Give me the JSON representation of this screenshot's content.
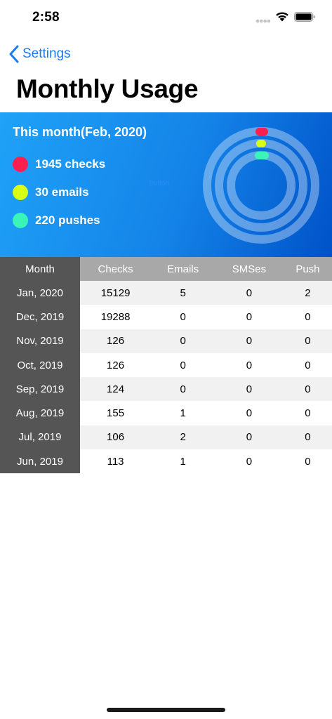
{
  "status_bar": {
    "time": "2:58"
  },
  "nav": {
    "back_label": "Settings"
  },
  "page": {
    "title": "Monthly Usage"
  },
  "summary": {
    "title": "This month(Feb, 2020)",
    "center_label": "Button",
    "items": [
      {
        "label": "1945 checks",
        "color": "#ff1f4f"
      },
      {
        "label": "30 emails",
        "color": "#d8ff14"
      },
      {
        "label": "220 pushes",
        "color": "#39f5b8"
      }
    ],
    "ring_colors": [
      "#ff1f4f",
      "#d8ff14",
      "#39f5b8"
    ]
  },
  "table": {
    "headers": [
      "Month",
      "Checks",
      "Emails",
      "SMSes",
      "Push"
    ],
    "rows": [
      [
        "Jan, 2020",
        "15129",
        "5",
        "0",
        "2"
      ],
      [
        "Dec, 2019",
        "19288",
        "0",
        "0",
        "0"
      ],
      [
        "Nov, 2019",
        "126",
        "0",
        "0",
        "0"
      ],
      [
        "Oct, 2019",
        "126",
        "0",
        "0",
        "0"
      ],
      [
        "Sep, 2019",
        "124",
        "0",
        "0",
        "0"
      ],
      [
        "Aug, 2019",
        "155",
        "1",
        "0",
        "0"
      ],
      [
        "Jul, 2019",
        "106",
        "2",
        "0",
        "0"
      ],
      [
        "Jun, 2019",
        "113",
        "1",
        "0",
        "0"
      ]
    ]
  }
}
